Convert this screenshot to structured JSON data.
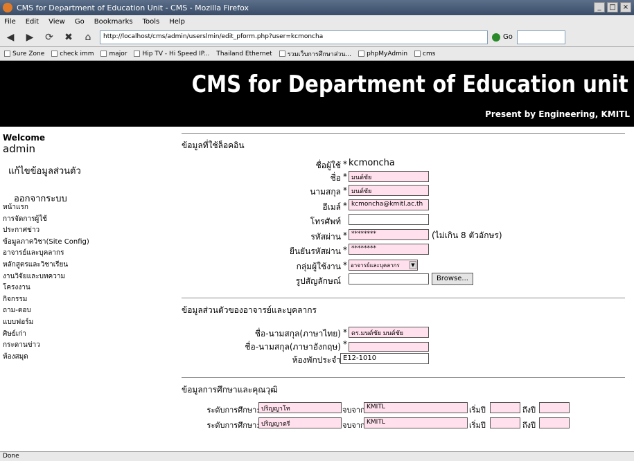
{
  "browser": {
    "title": "CMS for Department of Education Unit - CMS - Mozilla Firefox",
    "menu": [
      "File",
      "Edit",
      "View",
      "Go",
      "Bookmarks",
      "Tools",
      "Help"
    ],
    "url": "http://localhost/cms/admin/userslmin/edit_pform.php?user=kcmoncha",
    "go_label": "Go",
    "bookmarks": [
      "Sure Zone",
      "check imm",
      "major",
      "Hip TV - Hi Speed IP...",
      "Thailand Ethernet",
      "รวมเว็บการศึกษาส่วน...",
      "phpMyAdmin",
      "cms"
    ],
    "status": "Done"
  },
  "header": {
    "title": "CMS for Department of Education unit",
    "subtitle": "Present by Engineering, KMITL"
  },
  "sidebar": {
    "welcome": "Welcome",
    "username": "admin",
    "edit_profile": "แก้ไขข้อมูลส่วนตัว",
    "logout": "ออกจากระบบ",
    "items": [
      "หน้าแรก",
      "การจัดการผู้ใช้",
      "ประกาศข่าว",
      "ข้อมูลภาควิชา(Site Config)",
      "อาจารย์และบุคลากร",
      "หลักสูตรและวิชาเรียน",
      "งานวิจัยและบทความ",
      "โครงงาน",
      "กิจกรรม",
      "ถาม-ตอบ",
      "แบบฟอร์ม",
      "ศิษย์เก่า",
      "กระดานข่าว",
      "ห้องสมุด"
    ]
  },
  "form": {
    "section_account": "ข้อมูลที่ใช้ล็อคอิน",
    "username_label": "ชื่อผู้ใช้",
    "username_value": "kcmoncha",
    "name_label": "ชื่อ",
    "name_value": "มนต์ชัย",
    "surname_label": "นามสกุล",
    "surname_value": "มนต์ชัย",
    "email_label": "อีเมล์",
    "email_value": "kcmoncha@kmitl.ac.th",
    "phone_label": "โทรศัพท์",
    "phone_value": "",
    "password_label": "รหัสผ่าน",
    "password_value": "********",
    "password_hint": "(ไม่เกิน 8 ตัวอักษร)",
    "confirm_label": "ยืนยันรหัสผ่าน",
    "confirm_value": "********",
    "group_label": "กลุ่มผู้ใช้งาน",
    "group_value": "อาจารย์และบุคลากร",
    "photo_label": "รูปสัญลักษณ์",
    "browse_label": "Browse...",
    "section_personal": "ข้อมูลส่วนตัวของอาจารย์และบุคลากร",
    "thai_name_label": "ชื่อ-นามสกุล(ภาษาไทย)",
    "thai_name_value": "ดร.มนต์ชัย มนต์ชัย",
    "eng_name_label": "ชื่อ-นามสกุล(ภาษาอังกฤษ)",
    "eng_name_value": "",
    "office_label": "ห้องพักประจำ",
    "office_value": "E12-1010",
    "section_education": "ข้อมูลการศึกษาและคุณวุฒิ",
    "edu_rows": [
      {
        "level_label": "ระดับการศึกษา:",
        "level_value": "ปริญญาโท",
        "from_label": "จบจาก",
        "from_value": "KMITL",
        "start_label": "เริ่มปี",
        "start_value": "",
        "end_label": "ถึงปี",
        "end_value": ""
      },
      {
        "level_label": "ระดับการศึกษา:",
        "level_value": "ปริญญาตรี",
        "from_label": "จบจาก",
        "from_value": "KMITL",
        "start_label": "เริ่มปี",
        "start_value": "",
        "end_label": "ถึงปี",
        "end_value": ""
      }
    ]
  }
}
